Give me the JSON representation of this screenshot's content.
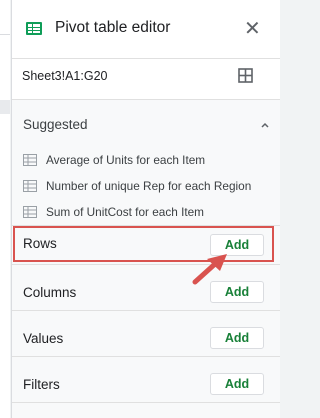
{
  "header": {
    "title": "Pivot table editor",
    "icon": "pivot-table-icon",
    "close_icon": "close-icon",
    "close_glyph": "✕"
  },
  "range": {
    "value": "Sheet3!A1:G20",
    "icon": "select-range-grid-icon"
  },
  "suggested": {
    "title": "Suggested",
    "items": [
      {
        "label": "Average of Units for each Item"
      },
      {
        "label": "Number of unique Rep for each Region"
      },
      {
        "label": "Sum of UnitCost for each Item"
      }
    ]
  },
  "fields": {
    "rows": {
      "label": "Rows",
      "add_label": "Add"
    },
    "columns": {
      "label": "Columns",
      "add_label": "Add"
    },
    "values": {
      "label": "Values",
      "add_label": "Add"
    },
    "filters": {
      "label": "Filters",
      "add_label": "Add"
    }
  },
  "colors": {
    "accent_green": "#188038",
    "highlight_red": "#d9534f",
    "panel_bg": "#f8f9fa"
  }
}
